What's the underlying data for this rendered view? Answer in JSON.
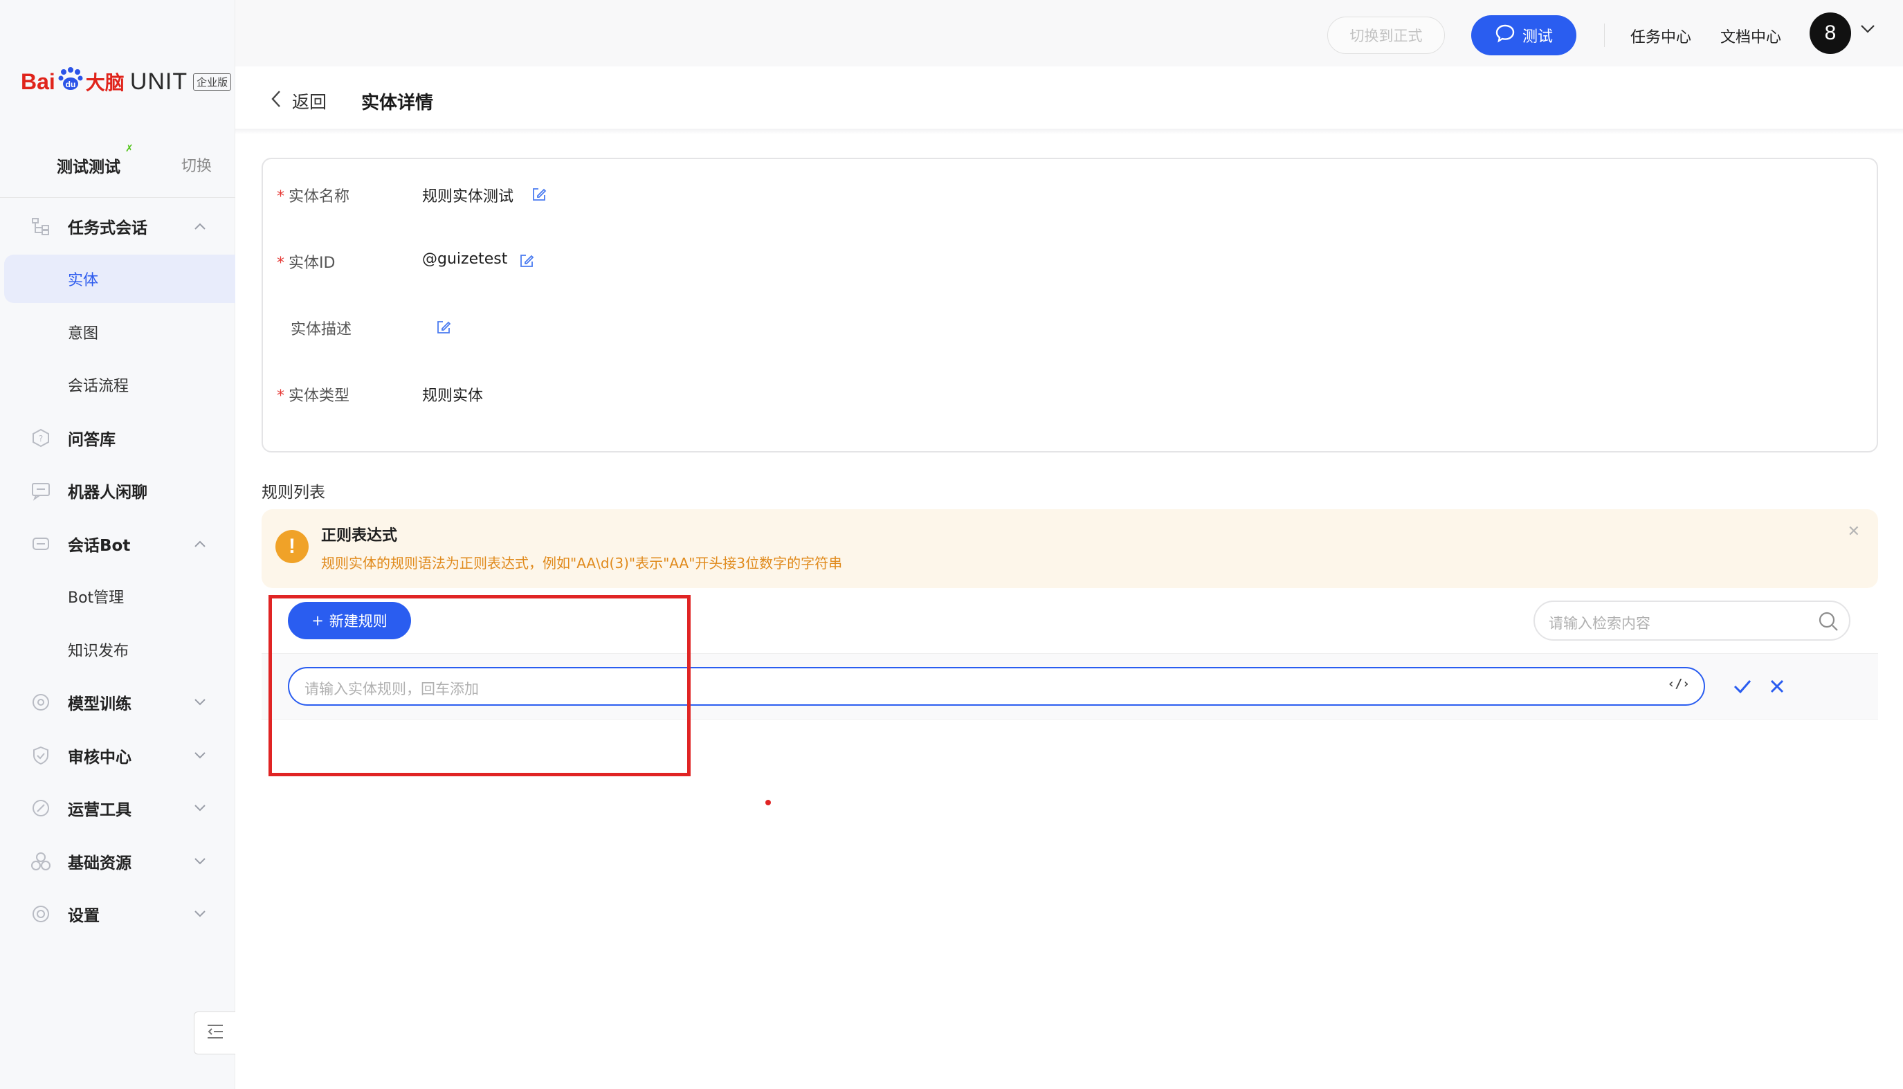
{
  "logo": {
    "bai": "Bai",
    "paw": "du",
    "danao": "大脑",
    "unit": "UNIT",
    "edition": "企业版"
  },
  "workspace": {
    "name": "测试测试",
    "switch_label": "切换"
  },
  "sidebar": {
    "sections": [
      {
        "label": "任务式会话",
        "icon": "tree-icon",
        "expanded": true
      },
      {
        "label": "问答库",
        "icon": "qa-icon"
      },
      {
        "label": "机器人闲聊",
        "icon": "chat-icon"
      },
      {
        "label": "会话Bot",
        "icon": "bot-icon",
        "expanded": true
      },
      {
        "label": "模型训练",
        "icon": "model-icon"
      },
      {
        "label": "审核中心",
        "icon": "shield-icon"
      },
      {
        "label": "运营工具",
        "icon": "tool-icon"
      },
      {
        "label": "基础资源",
        "icon": "resource-icon"
      },
      {
        "label": "设置",
        "icon": "gear-icon"
      }
    ],
    "task_subitems": [
      "实体",
      "意图",
      "会话流程"
    ],
    "bot_subitems": [
      "Bot管理",
      "知识发布"
    ],
    "active_item": "实体"
  },
  "topbar": {
    "switch_formal_label": "切换到正式",
    "test_label": "测试",
    "task_center": "任务中心",
    "doc_center": "文档中心",
    "avatar_text": "8"
  },
  "header": {
    "back_label": "返回",
    "title": "实体详情"
  },
  "entity": {
    "name_label": "实体名称",
    "name_value": "规则实体测试",
    "id_label": "实体ID",
    "id_value": "@guizetest",
    "desc_label": "实体描述",
    "desc_value": "",
    "type_label": "实体类型",
    "type_value": "规则实体"
  },
  "rules": {
    "list_title": "规则列表",
    "alert_title": "正则表达式",
    "alert_text": "规则实体的规则语法为正则表达式，例如\"AA\\d(3)\"表示\"AA\"开头接3位数字的字符串",
    "new_rule_label": "新建规则",
    "search_placeholder": "请输入检索内容",
    "rule_input_placeholder": "请输入实体规则，回车添加",
    "code_toggle": "‹/›"
  },
  "colors": {
    "primary": "#2a5df0",
    "warning": "#f0a228",
    "highlight": "#e02424",
    "required": "#e53935"
  }
}
